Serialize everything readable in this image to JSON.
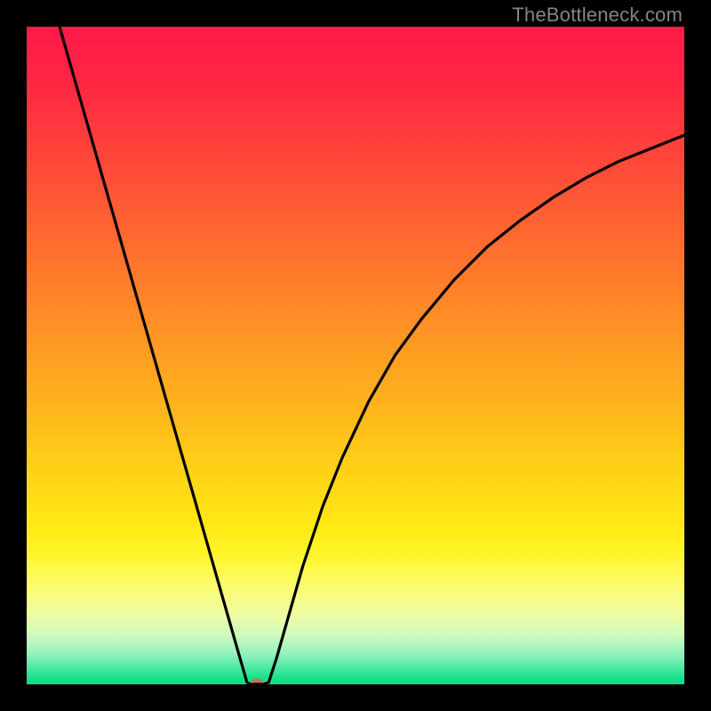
{
  "watermark": "TheBottleneck.com",
  "chart_data": {
    "type": "line",
    "title": "",
    "xlabel": "",
    "ylabel": "",
    "xlim": [
      0,
      100
    ],
    "ylim": [
      0,
      100
    ],
    "background_gradient_stops": [
      {
        "offset": 0.0,
        "color": "#ff1948"
      },
      {
        "offset": 0.08,
        "color": "#ff2543"
      },
      {
        "offset": 0.18,
        "color": "#ff403b"
      },
      {
        "offset": 0.28,
        "color": "#ff5d33"
      },
      {
        "offset": 0.38,
        "color": "#ff7b2b"
      },
      {
        "offset": 0.48,
        "color": "#ff9823"
      },
      {
        "offset": 0.58,
        "color": "#ffb51c"
      },
      {
        "offset": 0.68,
        "color": "#ffd316"
      },
      {
        "offset": 0.76,
        "color": "#ffe913"
      },
      {
        "offset": 0.8,
        "color": "#fff428"
      },
      {
        "offset": 0.85,
        "color": "#fcfc6e"
      },
      {
        "offset": 0.89,
        "color": "#f1fc9f"
      },
      {
        "offset": 0.925,
        "color": "#d0fabf"
      },
      {
        "offset": 0.955,
        "color": "#8ff2bc"
      },
      {
        "offset": 0.975,
        "color": "#4be9a2"
      },
      {
        "offset": 0.99,
        "color": "#18e18e"
      },
      {
        "offset": 1.0,
        "color": "#07de87"
      }
    ],
    "series": [
      {
        "name": "left-branch",
        "x": [
          5,
          10,
          15,
          20,
          25,
          30,
          32,
          33.5
        ],
        "y": [
          100,
          82.5,
          65,
          47.5,
          30,
          12.5,
          5.5,
          0.3
        ]
      },
      {
        "name": "bottom-flat",
        "x": [
          33.5,
          34.0,
          35.0,
          36.0,
          36.8
        ],
        "y": [
          0.3,
          0.0,
          0.0,
          0.0,
          0.3
        ]
      },
      {
        "name": "right-branch",
        "x": [
          36.8,
          38,
          40,
          42,
          45,
          48,
          52,
          56,
          60,
          65,
          70,
          75,
          80,
          85,
          90,
          95,
          100
        ],
        "y": [
          0.3,
          4,
          11,
          18,
          27,
          34.5,
          43,
          50,
          55.5,
          61.5,
          66.5,
          70.5,
          74,
          77,
          79.5,
          81.5,
          83.5
        ]
      }
    ],
    "marker": {
      "x": 35.0,
      "y": 0.2,
      "color": "#d46a56",
      "rx": 7,
      "ry": 5
    }
  }
}
